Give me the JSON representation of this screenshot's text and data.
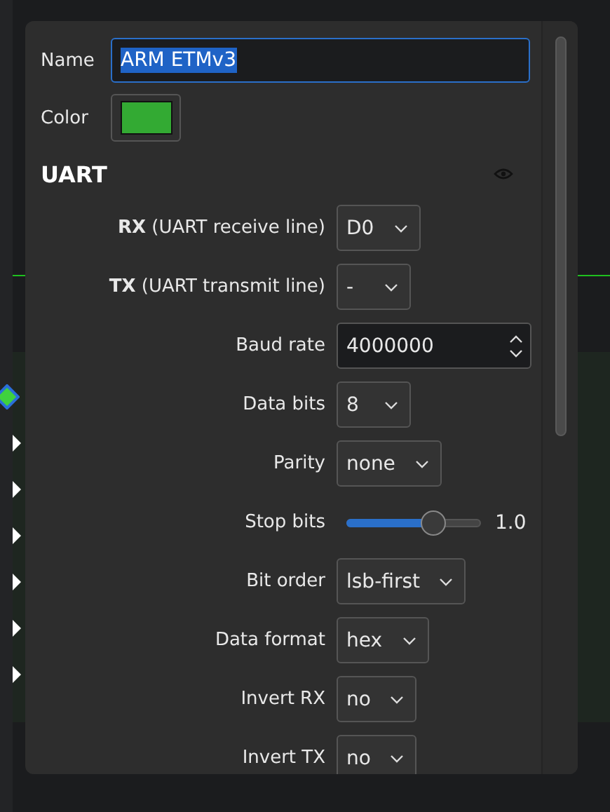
{
  "name_field": {
    "label": "Name",
    "value": "ARM ETMv3",
    "text_selected": true
  },
  "color_field": {
    "label": "Color",
    "color": "#33aa33"
  },
  "section": {
    "title": "UART"
  },
  "options": [
    {
      "kind": "select",
      "label": "**RX** (UART receive line)",
      "value": "D0"
    },
    {
      "kind": "select",
      "label": "**TX** (UART transmit line)",
      "value": "-"
    },
    {
      "kind": "spin",
      "label": "Baud rate",
      "value": "4000000"
    },
    {
      "kind": "select",
      "label": "Data bits",
      "value": "8"
    },
    {
      "kind": "select",
      "label": "Parity",
      "value": "none"
    },
    {
      "kind": "slider",
      "label": "Stop bits",
      "level": 0.65,
      "reading": "1.0"
    },
    {
      "kind": "select",
      "label": "Bit order",
      "value": "lsb-first"
    },
    {
      "kind": "select",
      "label": "Data format",
      "value": "hex"
    },
    {
      "kind": "select",
      "label": "Invert RX",
      "value": "no"
    },
    {
      "kind": "select",
      "label": "Invert TX",
      "value": "no"
    }
  ]
}
